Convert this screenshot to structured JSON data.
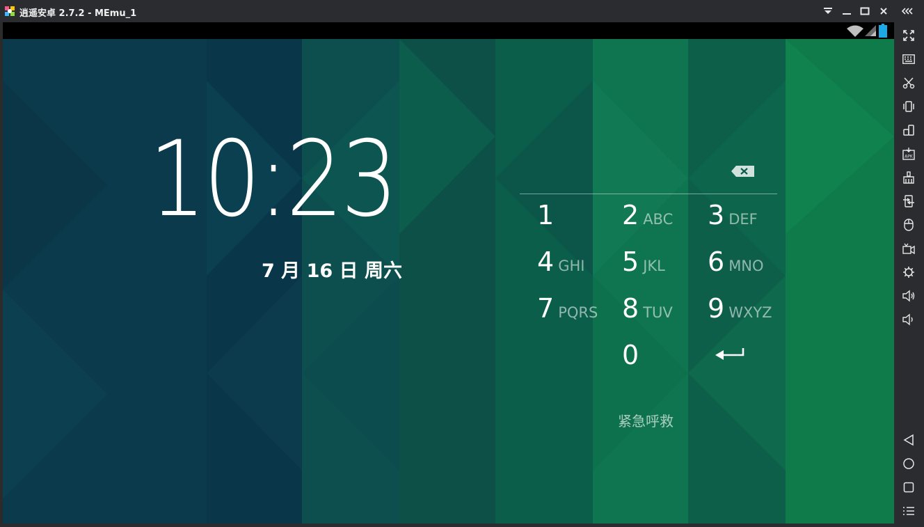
{
  "window": {
    "title": "逍遥安卓 2.7.2 - MEmu_1",
    "controls": [
      "dropdown-icon",
      "minimize-icon",
      "maximize-icon",
      "close-icon",
      "collapse-sidebar-icon"
    ]
  },
  "sidebar": {
    "top_tools": [
      "fullscreen-icon",
      "keyboard-icon",
      "scissors-icon",
      "shake-icon",
      "rotate-icon",
      "apk-install-icon",
      "clean-icon",
      "transfer-icon",
      "mouse-icon",
      "video-record-icon",
      "settings-icon",
      "volume-up-icon",
      "volume-down-icon"
    ],
    "nav_tools": [
      "back-icon",
      "home-icon",
      "recent-apps-icon",
      "menu-icon"
    ]
  },
  "statusbar": {
    "icons": [
      "wifi-icon",
      "signal-icon",
      "battery-icon"
    ]
  },
  "lockscreen": {
    "time": "10:23",
    "date": "7 月 16 日 周六",
    "keypad": [
      {
        "num": "1",
        "letters": ""
      },
      {
        "num": "2",
        "letters": "ABC"
      },
      {
        "num": "3",
        "letters": "DEF"
      },
      {
        "num": "4",
        "letters": "GHI"
      },
      {
        "num": "5",
        "letters": "JKL"
      },
      {
        "num": "6",
        "letters": "MNO"
      },
      {
        "num": "7",
        "letters": "PQRS"
      },
      {
        "num": "8",
        "letters": "TUV"
      },
      {
        "num": "9",
        "letters": "WXYZ"
      },
      {
        "num": "0",
        "letters": ""
      }
    ],
    "emergency_label": "紧急呼救"
  },
  "colors": {
    "titlebar": "#2b2c30",
    "bg_dark": "#0b3b4c",
    "bg_green": "#0f7a4a",
    "accent_battery": "#1ca9e6"
  }
}
